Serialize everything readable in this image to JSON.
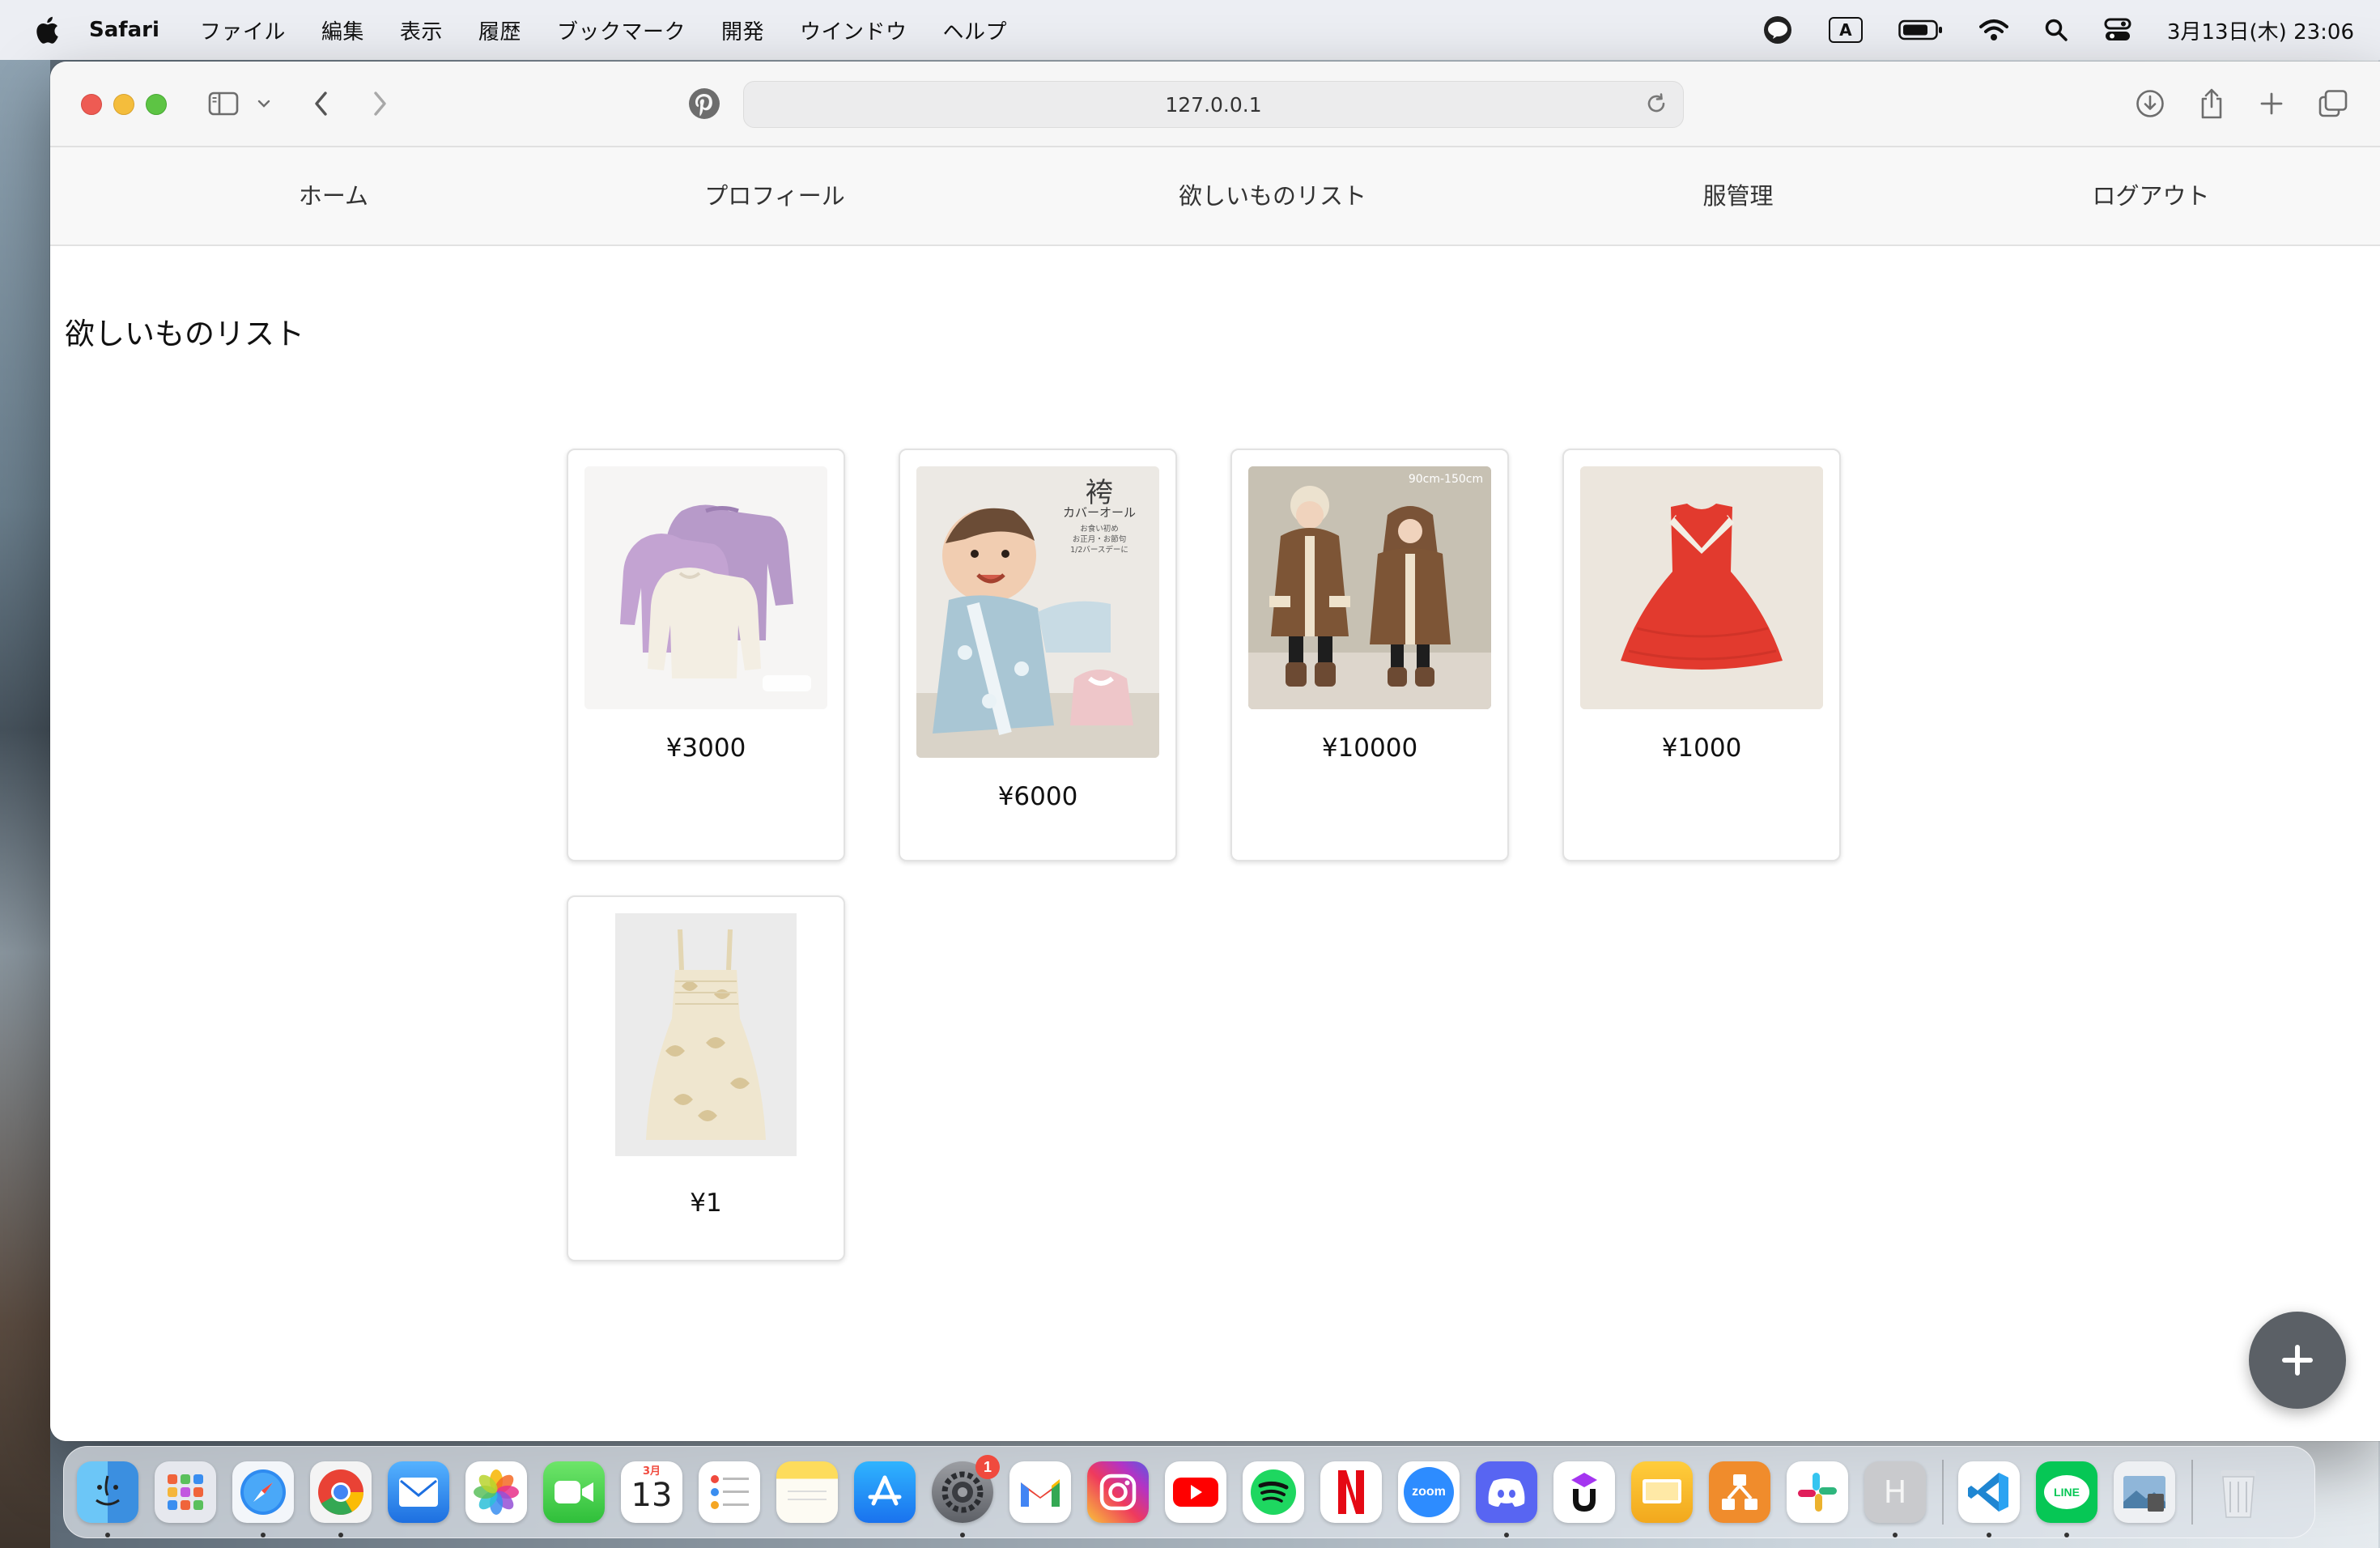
{
  "menubar": {
    "app_name": "Safari",
    "items": [
      "ファイル",
      "編集",
      "表示",
      "履歴",
      "ブックマーク",
      "開発",
      "ウインドウ",
      "ヘルプ"
    ],
    "input_mode": "A",
    "clock": "3月13日(木) 23:06"
  },
  "browser": {
    "url": "127.0.0.1"
  },
  "nav": {
    "links": [
      "ホーム",
      "プロフィール",
      "欲しいものリスト",
      "服管理",
      "ログアウト"
    ]
  },
  "main": {
    "title": "欲しいものリスト",
    "items": [
      {
        "price": "¥3000",
        "image": "knit-tops-lavender-cream"
      },
      {
        "price": "¥6000",
        "image": "hakama-coverall-baby",
        "image_title": "袴",
        "image_subtitle": "カバーオール",
        "image_caption": [
          "お食い初め",
          "お正月・お節句",
          "1/2バースデーに"
        ]
      },
      {
        "price": "¥10000",
        "image": "kids-brown-coats",
        "image_caption": [
          "90cm-150cm"
        ]
      },
      {
        "price": "¥1000",
        "image": "red-sailor-dress"
      },
      {
        "price": "¥1",
        "image": "cream-floral-sundress"
      }
    ]
  },
  "fab": {
    "label": "+"
  },
  "dock": {
    "calendar_month": "3月",
    "calendar_day": "13",
    "settings_badge": "1",
    "zoom_label": "zoom",
    "line_label": "LINE",
    "haiku_letter": "H",
    "app_icons": [
      "finder",
      "launchpad",
      "safari",
      "chrome",
      "mail",
      "photos",
      "facetime",
      "calendar",
      "reminders",
      "notes",
      "app-store",
      "system-settings",
      "gmail",
      "instagram",
      "youtube",
      "spotify",
      "netflix",
      "zoom",
      "discord",
      "udemy",
      "keynote",
      "draw",
      "slack",
      "haiku",
      "vscode",
      "line",
      "preview",
      "trash"
    ]
  },
  "colors": {
    "accent_red": "#e23a2e",
    "fab": "#5b6066"
  }
}
